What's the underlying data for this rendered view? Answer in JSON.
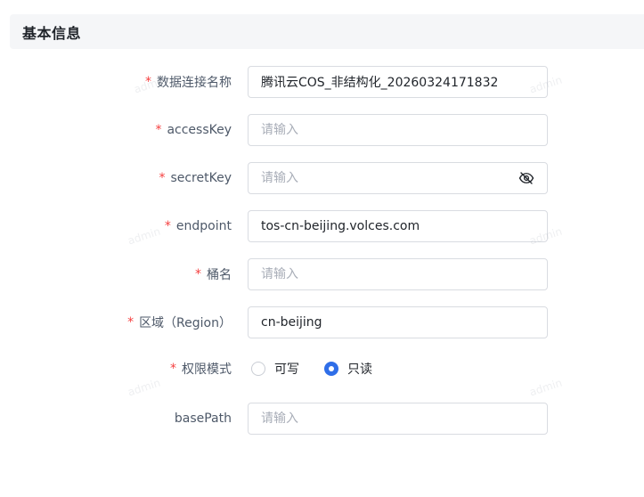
{
  "section": {
    "title": "基本信息"
  },
  "form": {
    "connection_name": {
      "label": "数据连接名称",
      "required": "*",
      "value": "腾讯云COS_非结构化_20260324171832",
      "placeholder": "请输入"
    },
    "access_key": {
      "label": "accessKey",
      "required": "*",
      "value": "",
      "placeholder": "请输入"
    },
    "secret_key": {
      "label": "secretKey",
      "required": "*",
      "value": "",
      "placeholder": "请输入",
      "toggle_icon": "eye-off-icon"
    },
    "endpoint": {
      "label": "endpoint",
      "required": "*",
      "value": "tos-cn-beijing.volces.com",
      "placeholder": "请输入"
    },
    "bucket": {
      "label": "桶名",
      "required": "*",
      "value": "",
      "placeholder": "请输入"
    },
    "region": {
      "label": "区域（Region）",
      "required": "*",
      "value": "cn-beijing",
      "placeholder": "请输入"
    },
    "permission_mode": {
      "label": "权限模式",
      "required": "*",
      "options": [
        {
          "label": "可写",
          "checked": false
        },
        {
          "label": "只读",
          "checked": true
        }
      ]
    },
    "base_path": {
      "label": "basePath",
      "value": "",
      "placeholder": "请输入"
    }
  },
  "watermark": {
    "text": "admin"
  },
  "colors": {
    "required_star": "#f53f3f",
    "radio_checked": "#2f6ee8",
    "header_background": "#f5f6f8",
    "input_border": "#d9dce1"
  }
}
